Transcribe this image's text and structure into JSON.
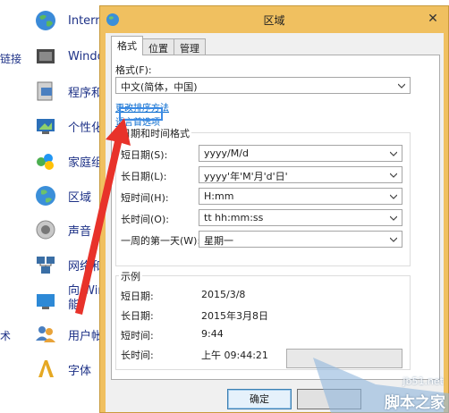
{
  "control_panel": {
    "left_fragments": [
      "链接",
      "术"
    ],
    "items": [
      {
        "label": "Intern",
        "icon": "globe-icon"
      },
      {
        "label": "Windo",
        "icon": "windows-update-icon"
      },
      {
        "label": "程序和",
        "icon": "programs-icon"
      },
      {
        "label": "个性化",
        "icon": "personalization-icon"
      },
      {
        "label": "家庭组",
        "icon": "homegroup-icon"
      },
      {
        "label": "区域",
        "icon": "region-icon"
      },
      {
        "label": "声音",
        "icon": "sound-icon"
      },
      {
        "label": "网络和",
        "icon": "network-icon"
      },
      {
        "label": "向 Wir",
        "label2": "能",
        "icon": "windows-features-icon"
      },
      {
        "label": "用户帐",
        "icon": "user-accounts-icon"
      },
      {
        "label": "字体",
        "icon": "fonts-icon"
      }
    ]
  },
  "dialog": {
    "title": "区域",
    "close_glyph": "✕",
    "tabs": [
      "格式",
      "位置",
      "管理"
    ],
    "active_tab": 0,
    "format_label": "格式(F):",
    "format_value": "中文(简体，中国)",
    "link_sort": "更改排序方法",
    "link_lang": "语言首选项",
    "datetime_group": {
      "title": "日期和时间格式",
      "rows": [
        {
          "label": "短日期(S):",
          "value": "yyyy/M/d"
        },
        {
          "label": "长日期(L):",
          "value": "yyyy'年'M'月'd'日'"
        },
        {
          "label": "短时间(H):",
          "value": "H:mm"
        },
        {
          "label": "长时间(O):",
          "value": "tt hh:mm:ss"
        },
        {
          "label": "一周的第一天(W):",
          "value": "星期一"
        }
      ]
    },
    "example_group": {
      "title": "示例",
      "rows": [
        {
          "label": "短日期:",
          "value": "2015/3/8"
        },
        {
          "label": "长日期:",
          "value": "2015年3月8日"
        },
        {
          "label": "短时间:",
          "value": "9:44"
        },
        {
          "label": "长时间:",
          "value": "上午 09:44:21"
        }
      ]
    },
    "ok_label": "确定"
  },
  "watermark": {
    "line1": "jb51.net",
    "line2": "脚本之家"
  },
  "colors": {
    "titlebar": "#f0c060",
    "link": "#0066cc",
    "arrow": "#e8322a",
    "highlight": "#3c8ce6"
  }
}
